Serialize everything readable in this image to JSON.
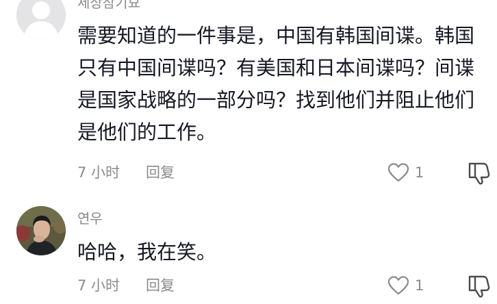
{
  "comments": [
    {
      "username": "세상참기묘",
      "lines": [
        "需要知道的一件事是，中国有韩国间谍。韩国",
        "只有中国间谍吗？有美国和日本间谍吗？间谍",
        "是国家战略的一部分吗？找到他们并阻止他们",
        "是他们的工作。"
      ],
      "time": "7 小时",
      "reply_label": "回复",
      "likes": "1"
    },
    {
      "username": "연우",
      "lines": [
        "哈哈，我在笑。"
      ],
      "time": "7 小时",
      "reply_label": "回复",
      "likes": "1"
    }
  ]
}
